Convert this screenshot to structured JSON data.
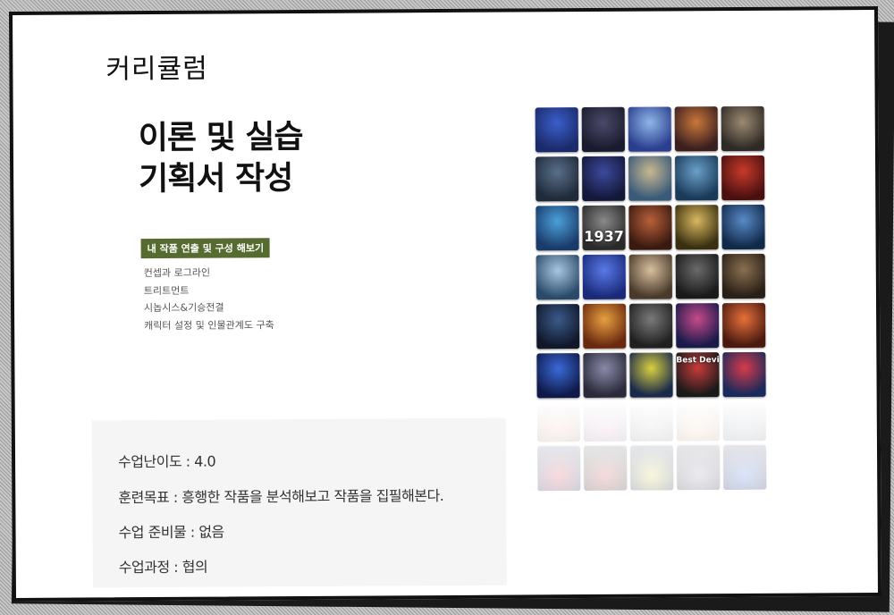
{
  "section_title": "커리큘럼",
  "headline": {
    "line1": "이론 및 실습",
    "line2": "기획서 작성"
  },
  "tag": "내 작품 연출 및 구성 해보기",
  "topics": [
    "컨셉과 로그라인",
    "트리트먼트",
    "시놉시스&기승전결",
    "캐릭터 설정 및 인물관계도 구축"
  ],
  "info": {
    "difficulty": "수업난이도 : 4.0",
    "goal": "훈련목표 : 흥행한 작품을 분석해보고 작품을 집필해본다.",
    "prep": "수업 준비물 : 없음",
    "process": "수업과정 : 협의"
  },
  "covers": [
    {
      "c1": "#1b2a6b",
      "c2": "#3a5fc9",
      "label": ""
    },
    {
      "c1": "#1a1a2e",
      "c2": "#4a4a6a",
      "label": ""
    },
    {
      "c1": "#2a3f8f",
      "c2": "#8fb6e8",
      "label": ""
    },
    {
      "c1": "#3b1f1f",
      "c2": "#c9783a",
      "label": ""
    },
    {
      "c1": "#2f2a26",
      "c2": "#9c8a72",
      "label": ""
    },
    {
      "c1": "#1f2a3a",
      "c2": "#5a6f8a",
      "label": ""
    },
    {
      "c1": "#14183a",
      "c2": "#3c4a9c",
      "label": ""
    },
    {
      "c1": "#3a5a7a",
      "c2": "#c8b890",
      "label": ""
    },
    {
      "c1": "#1a3a5a",
      "c2": "#6aa0c8",
      "label": ""
    },
    {
      "c1": "#4a1010",
      "c2": "#c83a2a",
      "label": ""
    },
    {
      "c1": "#1a3a6a",
      "c2": "#4aa0d8",
      "label": ""
    },
    {
      "c1": "#2a2a2a",
      "c2": "#8a8a8a",
      "label": "1937"
    },
    {
      "c1": "#3a1a10",
      "c2": "#b8603a",
      "label": ""
    },
    {
      "c1": "#3a3010",
      "c2": "#d8b860",
      "label": ""
    },
    {
      "c1": "#102a4a",
      "c2": "#5a8ac8",
      "label": ""
    },
    {
      "c1": "#2a4a6a",
      "c2": "#a8c8e0",
      "label": ""
    },
    {
      "c1": "#1a2a7a",
      "c2": "#5a7ae8",
      "label": ""
    },
    {
      "c1": "#4a3a2a",
      "c2": "#d8c0a0",
      "label": ""
    },
    {
      "c1": "#1a1a1a",
      "c2": "#6a6a6a",
      "label": ""
    },
    {
      "c1": "#2a2018",
      "c2": "#8a7050",
      "label": ""
    },
    {
      "c1": "#10182a",
      "c2": "#3a5a8a",
      "label": ""
    },
    {
      "c1": "#6a2a10",
      "c2": "#e8a040",
      "label": ""
    },
    {
      "c1": "#202020",
      "c2": "#7a7a7a",
      "label": ""
    },
    {
      "c1": "#1a1a4a",
      "c2": "#c84a8a",
      "label": ""
    },
    {
      "c1": "#4a1a10",
      "c2": "#e8703a",
      "label": ""
    },
    {
      "c1": "#101a4a",
      "c2": "#3a6ad8",
      "label": ""
    },
    {
      "c1": "#2a2a3a",
      "c2": "#8a8aa8",
      "label": ""
    },
    {
      "c1": "#1a2a4a",
      "c2": "#d8d040",
      "label": ""
    },
    {
      "c1": "#1a1a1a",
      "c2": "#c83a3a",
      "label": "Best Devil"
    },
    {
      "c1": "#1a2a5a",
      "c2": "#d83a4a",
      "label": ""
    }
  ]
}
